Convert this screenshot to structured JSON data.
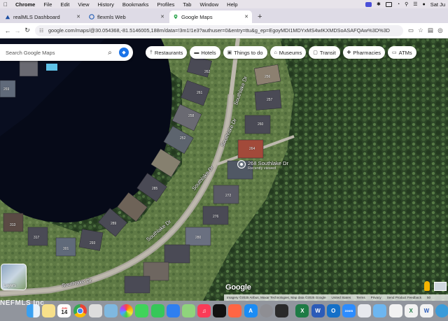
{
  "menubar": {
    "items": [
      "Chrome",
      "File",
      "Edit",
      "View",
      "History",
      "Bookmarks",
      "Profiles",
      "Tab",
      "Window",
      "Help"
    ],
    "clock": "Sat Ju"
  },
  "tabs": [
    {
      "title": "realMLS Dashboard",
      "active": false
    },
    {
      "title": "flexmls Web",
      "active": false
    },
    {
      "title": "Google Maps",
      "active": true
    }
  ],
  "address_bar": {
    "url": "google.com/maps/@30.054368,-81.5146005,188m/data=!3m1!1e3?authuser=0&entry=ttu&g_ep=EgoyMDI1MDYxMS4wIKXMDSoASAFQAw%3D%3D"
  },
  "search": {
    "placeholder": "Search Google Maps"
  },
  "chips": [
    {
      "label": "Restaurants",
      "icon": "fork-knife-icon"
    },
    {
      "label": "Hotels",
      "icon": "bed-icon"
    },
    {
      "label": "Things to do",
      "icon": "camera-icon"
    },
    {
      "label": "Museums",
      "icon": "museum-icon"
    },
    {
      "label": "Transit",
      "icon": "train-icon"
    },
    {
      "label": "Pharmacies",
      "icon": "pharmacy-icon"
    },
    {
      "label": "ATMs",
      "icon": "atm-icon"
    }
  ],
  "map": {
    "pin_label": "268 Southlake Dr",
    "pin_sub": "Recently viewed",
    "streets": [
      "Southlake Dr",
      "Southlake Dr",
      "Southlake Dr",
      "Southlake Dr",
      "Southlake Dr"
    ],
    "house_numbers": [
      "262",
      "261",
      "258",
      "256",
      "257",
      "260",
      "252",
      "264",
      "268",
      "272",
      "276",
      "280",
      "284",
      "285",
      "289",
      "293",
      "301",
      "305",
      "309",
      "313",
      "317",
      "276",
      "249",
      "253",
      "265",
      "269",
      "237",
      "244"
    ],
    "layers_label": "Layers",
    "logo": "Google",
    "attribution": [
      "Imagery ©2025 Airbus, Maxar Technologies, Map data ©2025 Google",
      "United States",
      "Terms",
      "Privacy",
      "Send Product Feedback",
      "50"
    ],
    "watermark": "NEFMLS Inc"
  },
  "dock": {
    "calendar_day": "14",
    "calendar_month": "JUN"
  }
}
